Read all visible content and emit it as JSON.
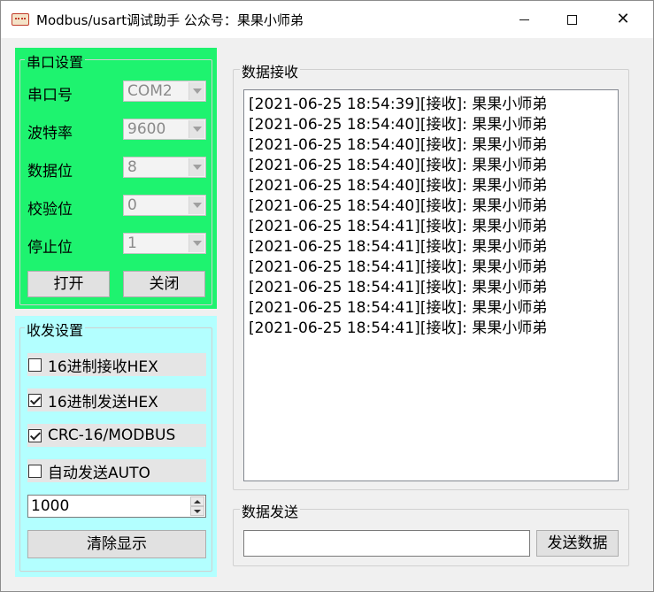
{
  "window": {
    "title": "Modbus/usart调试助手  公众号：果果小师弟",
    "icon": "app-icon",
    "controls": {
      "minimize": "minimize-icon",
      "maximize": "maximize-icon",
      "close": "close-icon"
    }
  },
  "serial": {
    "title": "串口设置",
    "bg_color": "#1ef36f",
    "fields": [
      {
        "label": "串口号",
        "value": "COM2"
      },
      {
        "label": "波特率",
        "value": "9600"
      },
      {
        "label": "数据位",
        "value": "8"
      },
      {
        "label": "校验位",
        "value": "0"
      },
      {
        "label": "停止位",
        "value": "1"
      }
    ],
    "open_label": "打开",
    "close_label": "关闭"
  },
  "txrx": {
    "title": "收发设置",
    "bg_color": "#b3ffff",
    "options": [
      {
        "label": "16进制接收HEX",
        "checked": false
      },
      {
        "label": "16进制发送HEX",
        "checked": true
      },
      {
        "label": "CRC-16/MODBUS",
        "checked": true
      },
      {
        "label": "自动发送AUTO",
        "checked": false
      }
    ],
    "interval_value": "1000",
    "clear_label": "清除显示"
  },
  "receive": {
    "title": "数据接收",
    "lines": [
      "[2021-06-25 18:54:39][接收]: 果果小师弟",
      "[2021-06-25 18:54:40][接收]: 果果小师弟",
      "[2021-06-25 18:54:40][接收]: 果果小师弟",
      "[2021-06-25 18:54:40][接收]: 果果小师弟",
      "[2021-06-25 18:54:40][接收]: 果果小师弟",
      "[2021-06-25 18:54:40][接收]: 果果小师弟",
      "[2021-06-25 18:54:41][接收]: 果果小师弟",
      "[2021-06-25 18:54:41][接收]: 果果小师弟",
      "[2021-06-25 18:54:41][接收]: 果果小师弟",
      "[2021-06-25 18:54:41][接收]: 果果小师弟",
      "[2021-06-25 18:54:41][接收]: 果果小师弟",
      "[2021-06-25 18:54:41][接收]: 果果小师弟"
    ]
  },
  "send": {
    "title": "数据发送",
    "value": "",
    "send_label": "发送数据"
  }
}
